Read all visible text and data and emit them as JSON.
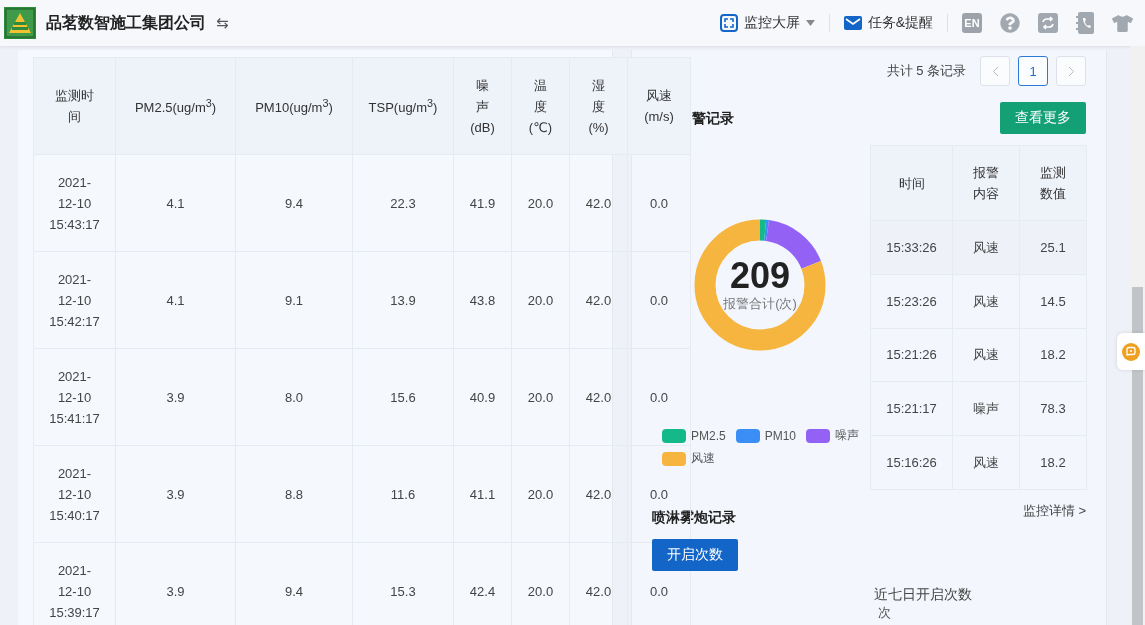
{
  "header": {
    "company": "品茗数智施工集团公司",
    "switch_glyph": "⇆",
    "menus": [
      {
        "kind": "screen",
        "label": "监控大屏"
      },
      {
        "kind": "mail",
        "label": "任务&提醒"
      }
    ],
    "lang": "EN"
  },
  "records": {
    "columns": [
      "监测时间",
      "PM2.5(ug/m$^{3}$)",
      "PM10(ug/m$^{3}$)",
      "TSP(ug/m$^{3}$)",
      "噪声(dB)",
      "温度(℃)",
      "湿度(%)",
      "风速(m/s)"
    ],
    "rows": [
      [
        "2021-12-10 15:43:17",
        "4.1",
        "9.4",
        "22.3",
        "41.9",
        "20.0",
        "42.0",
        "0.0"
      ],
      [
        "2021-12-10 15:42:17",
        "4.1",
        "9.1",
        "13.9",
        "43.8",
        "20.0",
        "42.0",
        "0.0"
      ],
      [
        "2021-12-10 15:41:17",
        "3.9",
        "8.0",
        "15.6",
        "40.9",
        "20.0",
        "42.0",
        "0.0"
      ],
      [
        "2021-12-10 15:40:17",
        "3.9",
        "8.8",
        "11.6",
        "41.1",
        "20.0",
        "42.0",
        "0.0"
      ],
      [
        "2021-12-10 15:39:17",
        "3.9",
        "9.4",
        "15.3",
        "42.4",
        "20.0",
        "42.0",
        "0.0"
      ]
    ]
  },
  "pagination": {
    "summary": "共计 5 条记录",
    "pages": [
      {
        "label": "1",
        "selected": true
      }
    ]
  },
  "alarm": {
    "title": "警记录",
    "more_button": "查看更多",
    "total": "209",
    "total_label": "报警合计(次)",
    "legend": [
      {
        "label": "PM2.5",
        "color": "#14b98a"
      },
      {
        "label": "PM10",
        "color": "#3a8ef6"
      },
      {
        "label": "噪声",
        "color": "#9461f5"
      },
      {
        "label": "风速",
        "color": "#f5b53f"
      }
    ],
    "columns": [
      "时间",
      "报警内容",
      "监测数值"
    ],
    "rows": [
      [
        "15:33:26",
        "风速",
        "25.1"
      ],
      [
        "15:23:26",
        "风速",
        "14.5"
      ],
      [
        "15:21:26",
        "风速",
        "18.2"
      ],
      [
        "15:21:17",
        "噪声",
        "78.3"
      ],
      [
        "15:16:26",
        "风速",
        "18.2"
      ]
    ]
  },
  "spray": {
    "title": "喷淋雾炮记录",
    "tab": "开启次数",
    "detail_link": "监控详情 >",
    "chart_title": "近七日开启次数",
    "unit": "次"
  }
}
